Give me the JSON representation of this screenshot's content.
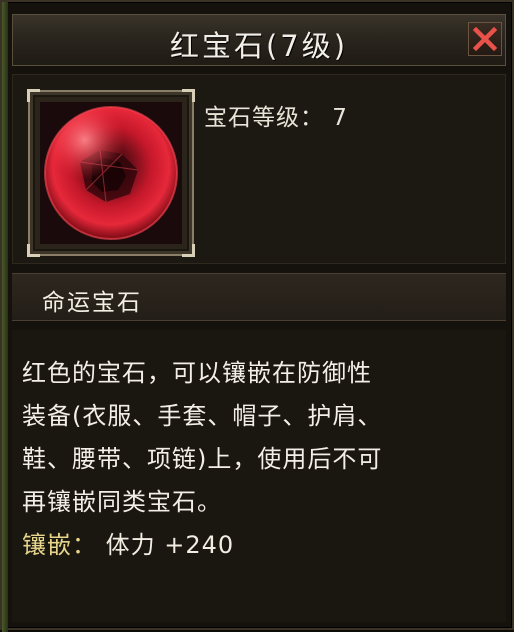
{
  "tooltip": {
    "title": "红宝石(7级)",
    "close_icon": "close-x-icon",
    "icon_name": "red-gem-icon",
    "level_text": "宝石等级： 7",
    "section_label": "命运宝石",
    "description_lines": [
      "红色的宝石，可以镶嵌在防御性",
      "装备(衣服、手套、帽子、护肩、",
      "鞋、腰带、项链)上，使用后不可",
      "再镶嵌同类宝石。"
    ],
    "inlay_label": "镶嵌：",
    "inlay_value": "体力 +240"
  },
  "colors": {
    "title_text": "#f2efe8",
    "close_x": "#e8524a",
    "inlay_label": "#e6d58a",
    "gem_red": "#d21a2a"
  }
}
